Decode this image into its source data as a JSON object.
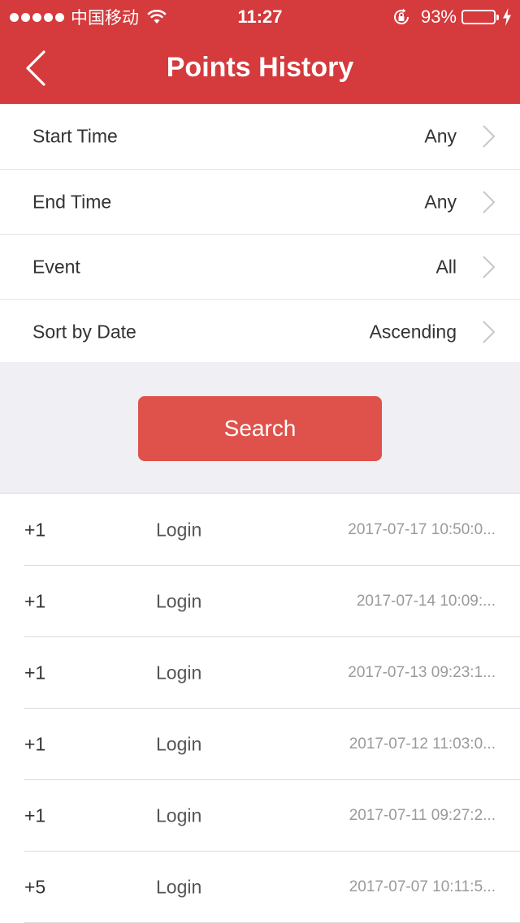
{
  "status_bar": {
    "carrier": "中国移动",
    "time": "11:27",
    "battery_percent": "93%",
    "battery_level": 0.93,
    "signal_bars": 5,
    "icons": [
      "wifi-icon",
      "lock-rotation-icon",
      "battery-icon",
      "charging-icon"
    ]
  },
  "nav": {
    "title": "Points History",
    "back_icon": "chevron-left-icon"
  },
  "filters": [
    {
      "label": "Start Time",
      "value": "Any"
    },
    {
      "label": "End Time",
      "value": "Any"
    },
    {
      "label": "Event",
      "value": "All"
    },
    {
      "label": "Sort by Date",
      "value": "Ascending"
    }
  ],
  "search": {
    "label": "Search"
  },
  "history": [
    {
      "points": "+1",
      "event": "Login",
      "date": "2017-07-17 10:50:0..."
    },
    {
      "points": "+1",
      "event": "Login",
      "date": "2017-07-14 10:09:..."
    },
    {
      "points": "+1",
      "event": "Login",
      "date": "2017-07-13 09:23:1..."
    },
    {
      "points": "+1",
      "event": "Login",
      "date": "2017-07-12 11:03:0..."
    },
    {
      "points": "+1",
      "event": "Login",
      "date": "2017-07-11 09:27:2..."
    },
    {
      "points": "+5",
      "event": "Login",
      "date": "2017-07-07 10:11:5..."
    }
  ],
  "colors": {
    "brand_red": "#d53a3c",
    "button_red": "#de524b",
    "background_gray": "#efeff4",
    "battery_green": "#4cd964"
  }
}
